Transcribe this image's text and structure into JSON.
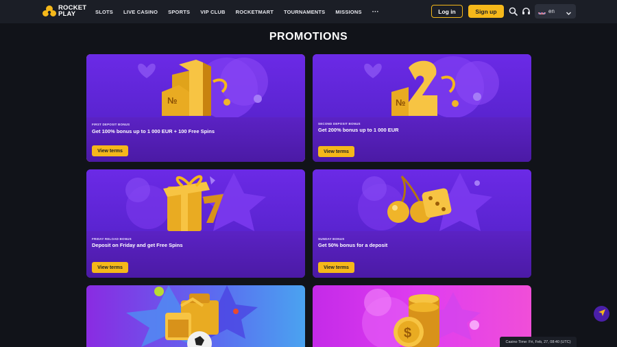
{
  "brand": {
    "line1": "ROCKET",
    "line2": "PLAY"
  },
  "nav": {
    "items": [
      "SLOTS",
      "LIVE CASINO",
      "SPORTS",
      "VIP CLUB",
      "ROCKETMART",
      "TOURNAMENTS",
      "MISSIONS"
    ],
    "more": "···"
  },
  "auth": {
    "login": "Log in",
    "signup": "Sign up"
  },
  "language": {
    "label": "en"
  },
  "page": {
    "title": "PROMOTIONS"
  },
  "promotions": [
    {
      "kicker": "FIRST DEPOSIT BONUS",
      "title": "Get 100% bonus up to 1 000 EUR + 100 Free Spins",
      "button": "View terms",
      "art": "number-one-trophy"
    },
    {
      "kicker": "SECOND DEPOSIT BONUS",
      "title": "Get 200% bonus up to 1 000 EUR",
      "button": "View terms",
      "art": "number-two-trophy"
    },
    {
      "kicker": "FRIDAY RELOAD BONUS",
      "title": "Deposit on Friday and get Free Spins",
      "button": "View terms",
      "art": "gift-seven"
    },
    {
      "kicker": "SUNDAY BONUS",
      "title": "Get 50% bonus for a deposit",
      "button": "View terms",
      "art": "cherries-dice"
    },
    {
      "kicker": "",
      "title": "",
      "button": "",
      "art": "calendar-gift-ball"
    },
    {
      "kicker": "",
      "title": "",
      "button": "",
      "art": "gold-coins"
    }
  ],
  "footer": {
    "casino_time": "Casino Time: Fri, Feb, 27, 08:40 (UTC)"
  },
  "colors": {
    "accent": "#f5b81a",
    "header_bg": "#1b1e26",
    "page_bg": "#111319",
    "card_purple": "#5a23b8"
  }
}
